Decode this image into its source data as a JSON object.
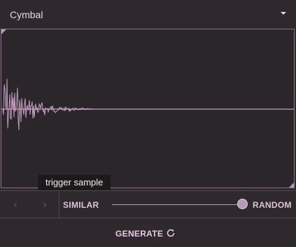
{
  "header": {
    "title": "Cymbal"
  },
  "tooltip": {
    "text": "trigger sample"
  },
  "controls": {
    "prev_icon": "‹",
    "next_icon": "›",
    "similar_label": "SIMILAR",
    "random_label": "RANDOM",
    "slider_value": 1.0
  },
  "generate": {
    "label": "GENERATE",
    "icon": "refresh-icon"
  },
  "colors": {
    "background": "#2f292d",
    "panel": "#2b2629",
    "waveform": "#c49fc3",
    "accent_text": "#e6cce4",
    "disabled": "#5c5459"
  }
}
